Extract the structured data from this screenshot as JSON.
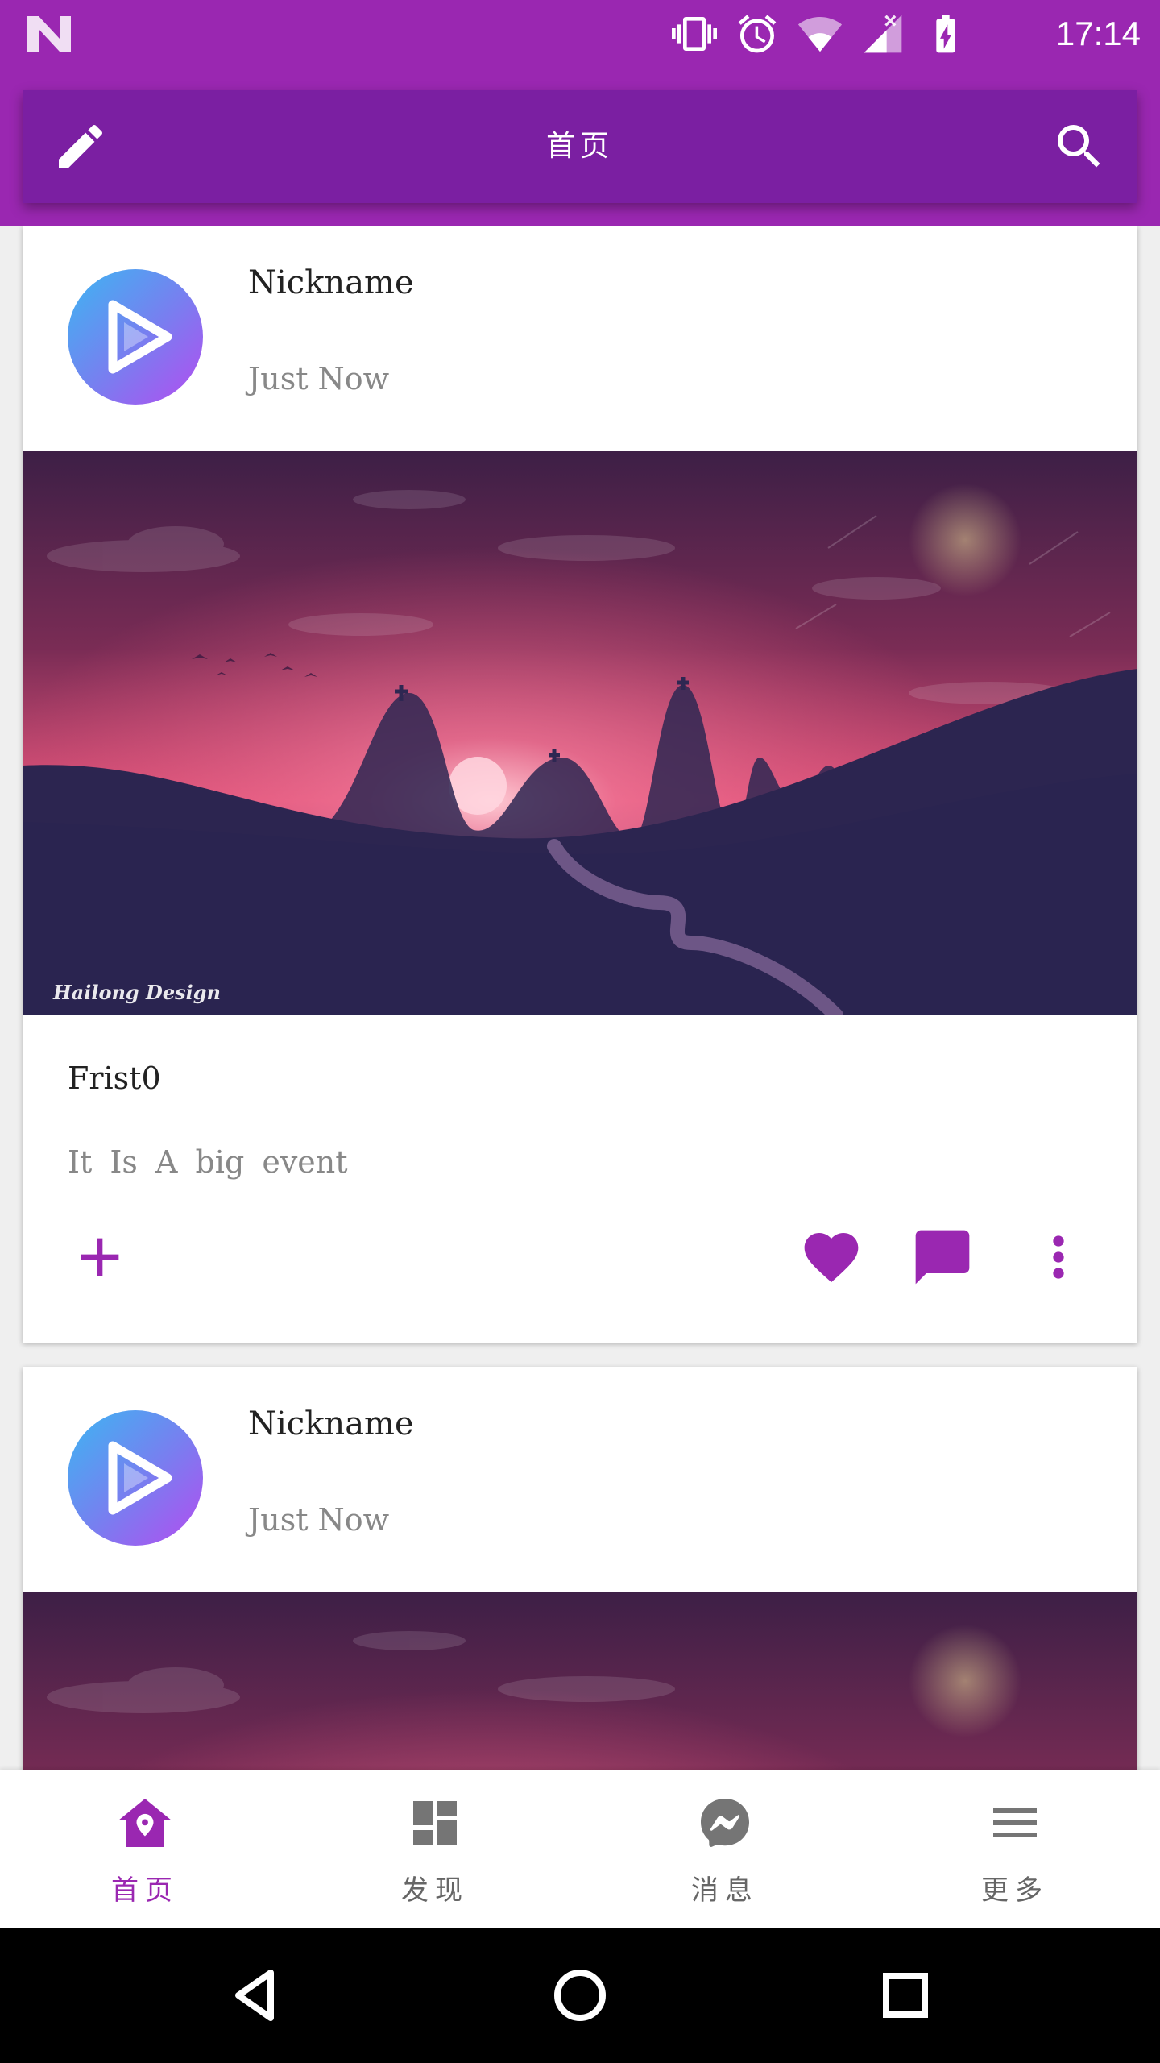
{
  "status_bar": {
    "time": "17:14",
    "icons": [
      "n-logo-icon",
      "vibrate-icon",
      "alarm-icon",
      "wifi-icon",
      "signal-icon",
      "battery-charging-icon"
    ]
  },
  "toolbar": {
    "title": "首页",
    "left_icon": "edit-icon",
    "right_icon": "search-icon"
  },
  "posts": [
    {
      "nickname": "Nickname",
      "time": "Just Now",
      "title": "Frist0",
      "description": "It Is A big event",
      "image_caption": "Hailong Design"
    },
    {
      "nickname": "Nickname",
      "time": "Just Now"
    }
  ],
  "actions": [
    "add-icon",
    "heart-icon",
    "comment-icon",
    "more-vert-icon"
  ],
  "bottom_nav": [
    {
      "label": "首页",
      "icon": "home-location-icon",
      "active": true
    },
    {
      "label": "发现",
      "icon": "dashboard-icon",
      "active": false
    },
    {
      "label": "消息",
      "icon": "messenger-icon",
      "active": false
    },
    {
      "label": "更多",
      "icon": "menu-icon",
      "active": false
    }
  ],
  "colors": {
    "primary": "#9a27b1",
    "primary_dark": "#7b1fa2",
    "inactive_icon": "#757575"
  }
}
